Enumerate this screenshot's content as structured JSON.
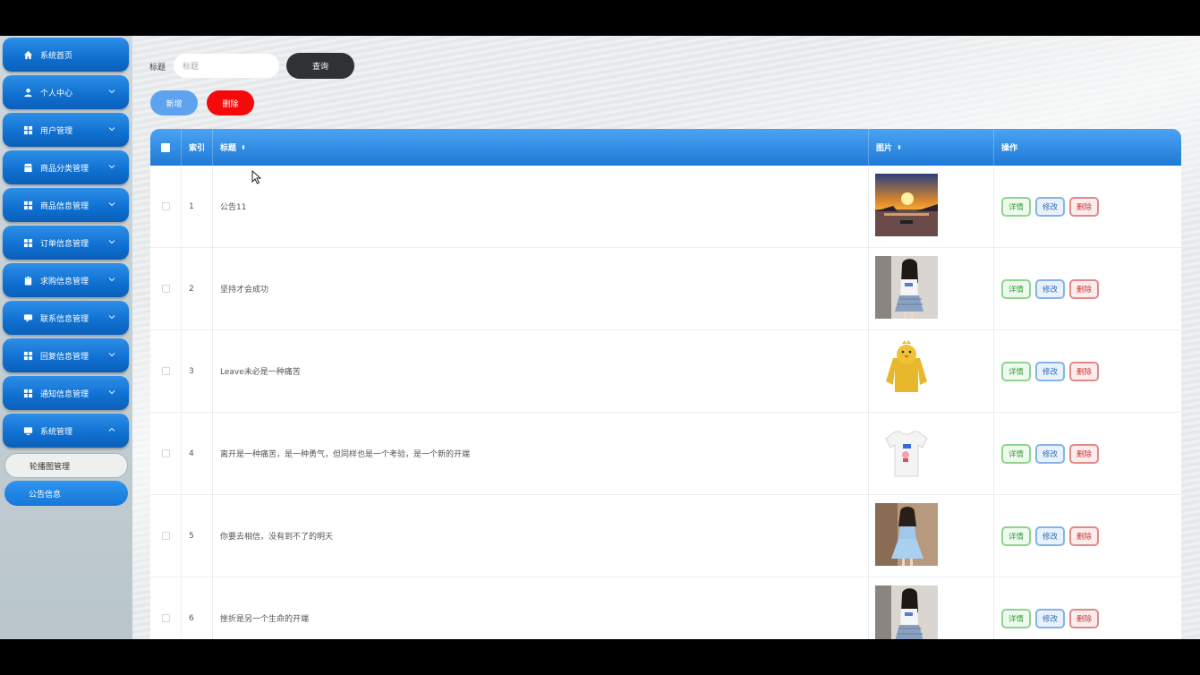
{
  "sidebar": {
    "items": [
      {
        "label": "系统首页",
        "icon": "home-icon",
        "has_arrow": false
      },
      {
        "label": "个人中心",
        "icon": "user-icon",
        "has_arrow": true
      },
      {
        "label": "用户管理",
        "icon": "grid-icon",
        "has_arrow": true
      },
      {
        "label": "商品分类管理",
        "icon": "shop-icon",
        "has_arrow": true
      },
      {
        "label": "商品信息管理",
        "icon": "grid-icon",
        "has_arrow": true
      },
      {
        "label": "订单信息管理",
        "icon": "grid-icon",
        "has_arrow": true
      },
      {
        "label": "求购信息管理",
        "icon": "clipboard-icon",
        "has_arrow": true
      },
      {
        "label": "联系信息管理",
        "icon": "comment-icon",
        "has_arrow": true
      },
      {
        "label": "回复信息管理",
        "icon": "grid-icon",
        "has_arrow": true
      },
      {
        "label": "通知信息管理",
        "icon": "grid-icon",
        "has_arrow": true
      },
      {
        "label": "系统管理",
        "icon": "monitor-icon",
        "has_arrow": true,
        "expanded": true
      }
    ],
    "subitems": [
      {
        "label": "轮播图管理",
        "active": false
      },
      {
        "label": "公告信息",
        "active": true
      }
    ]
  },
  "search": {
    "label": "标题",
    "placeholder": "标题",
    "value": "",
    "query_label": "查询"
  },
  "actions": {
    "add_label": "新增",
    "delete_label": "删除"
  },
  "table": {
    "columns": [
      "",
      "索引",
      "标题",
      "图片",
      "操作"
    ],
    "rows": [
      {
        "index": "1",
        "title": "公告11",
        "image": "sunset"
      },
      {
        "index": "2",
        "title": "坚持才会成功",
        "image": "girl"
      },
      {
        "index": "3",
        "title": "Leave未必是一种痛苦",
        "image": "yellow-hoodie"
      },
      {
        "index": "4",
        "title": "离开是一种痛苦，是一种勇气，但同样也是一个考验，是一个新的开端",
        "image": "white-tshirt"
      },
      {
        "index": "5",
        "title": "你要去相信，没有到不了的明天",
        "image": "girl-dress"
      },
      {
        "index": "6",
        "title": "挫折是另一个生命的开端",
        "image": "girl"
      }
    ],
    "row_actions": {
      "detail": "详情",
      "edit": "修改",
      "delete": "删除"
    }
  },
  "colors": {
    "menu_blue": "#0f6fd0",
    "header_blue": "#2f88e0",
    "query_dark": "#2e3234",
    "add_blue": "#5da3ef",
    "delete_red": "#f40a0a"
  }
}
